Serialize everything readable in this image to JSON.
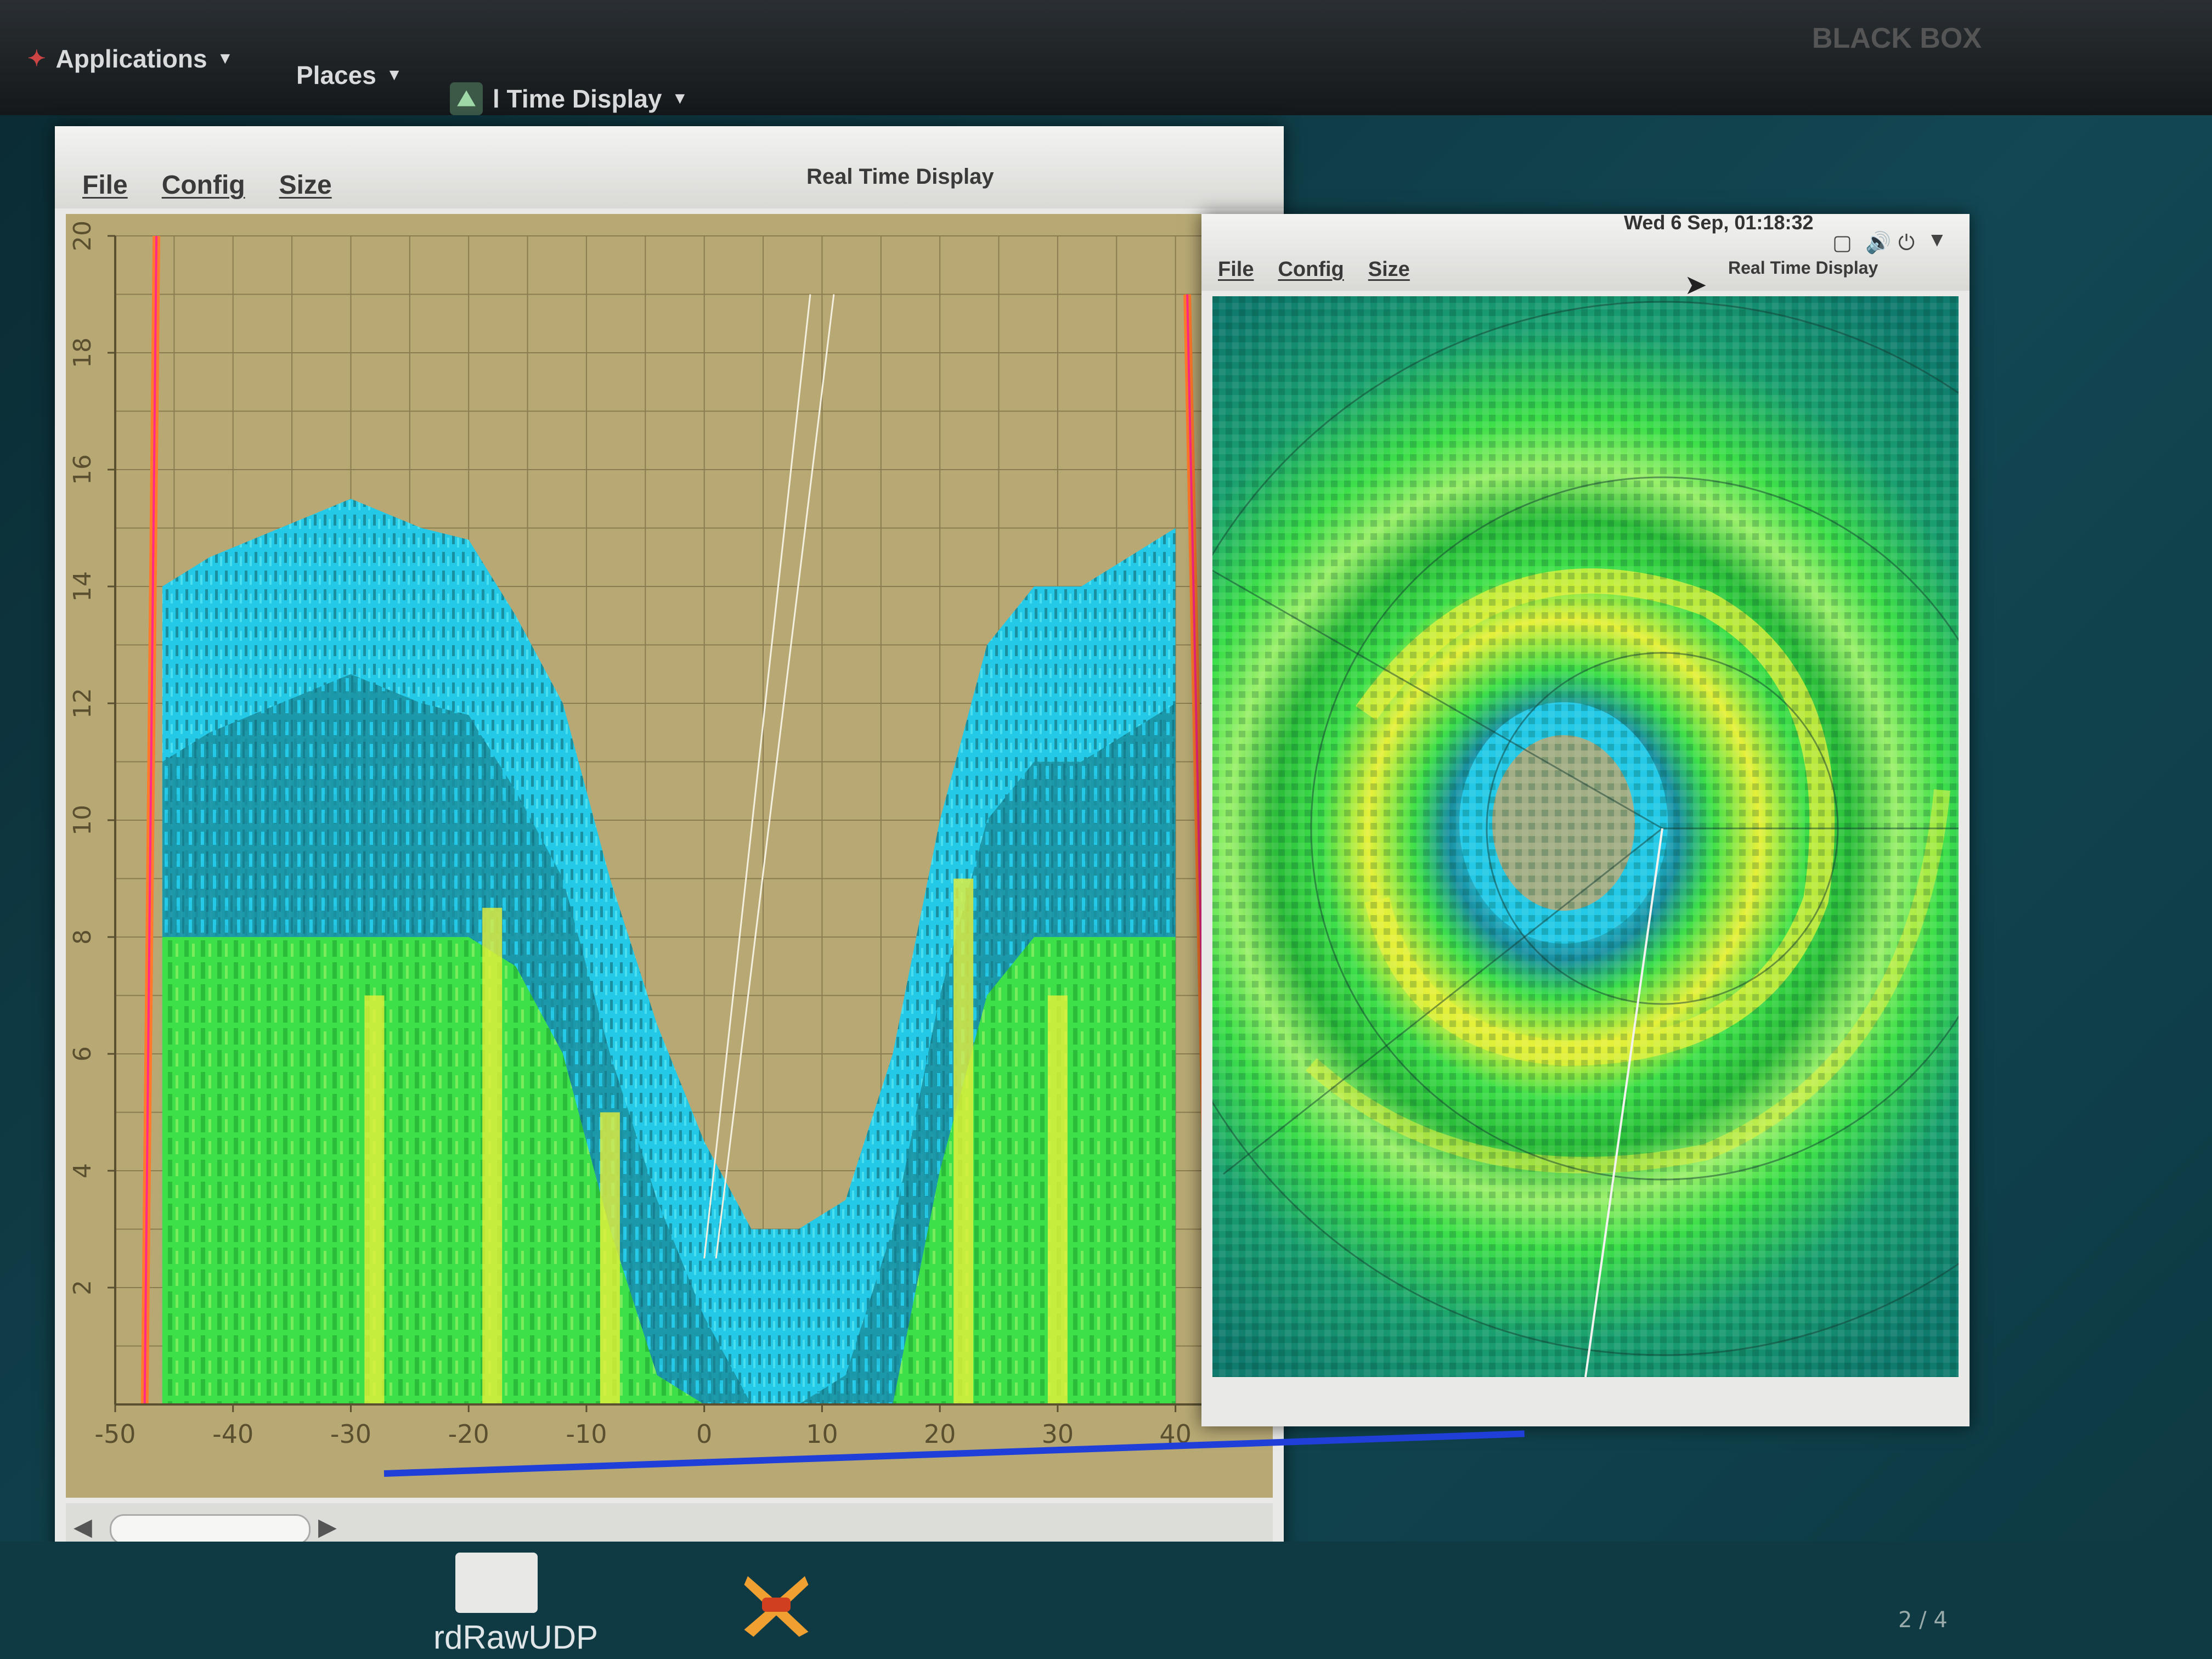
{
  "top_panel": {
    "applications_label": "Applications",
    "places_label": "Places",
    "active_app_label": "l Time Display",
    "brand": "BLACK BOX"
  },
  "clock": "Wed  6 Sep, 01:18:32",
  "left_window": {
    "menu": [
      "File",
      "Config",
      "Size"
    ],
    "title": "Real Time Display",
    "y_ticks": [
      "2",
      "4",
      "6",
      "8",
      "10",
      "12",
      "14",
      "16",
      "18",
      "20"
    ],
    "x_ticks": [
      "-50",
      "-40",
      "-30",
      "-20",
      "-10",
      "0",
      "10",
      "20",
      "30",
      "40"
    ]
  },
  "right_window": {
    "menu": [
      "File",
      "Config",
      "Size"
    ],
    "title": "Real Time Display"
  },
  "taskbar": {
    "task_label": "rdRawUDP",
    "pager": "2 / 4"
  },
  "colors": {
    "plot_background": "#b8a974",
    "echo_cyan": "#23c9e6",
    "echo_teal": "#1a8fa0",
    "echo_green": "#3ee04a",
    "echo_yellow": "#e6f03a",
    "echo_red": "#ff3a3a",
    "radar_background": "#0f7a6e"
  },
  "chart_data": {
    "type": "heatmap",
    "x_ticks": [
      -50,
      -40,
      -30,
      -20,
      -10,
      0,
      10,
      20,
      30,
      40
    ],
    "y_ticks": [
      2,
      4,
      6,
      8,
      10,
      12,
      14,
      16,
      18,
      20
    ],
    "xlim": [
      -50,
      45
    ],
    "ylim": [
      0,
      20
    ],
    "echo_top_profile": {
      "x": [
        -46,
        -42,
        -36,
        -30,
        -24,
        -20,
        -16,
        -12,
        -8,
        -4,
        0,
        4,
        8,
        12,
        16,
        20,
        24,
        28,
        32,
        36,
        40
      ],
      "y": [
        14,
        14.5,
        15,
        15.5,
        15,
        14.8,
        13.5,
        12,
        9,
        6.5,
        4.5,
        3,
        3,
        3.5,
        6,
        10,
        13,
        14,
        14,
        14.5,
        15
      ]
    },
    "grid": true
  }
}
